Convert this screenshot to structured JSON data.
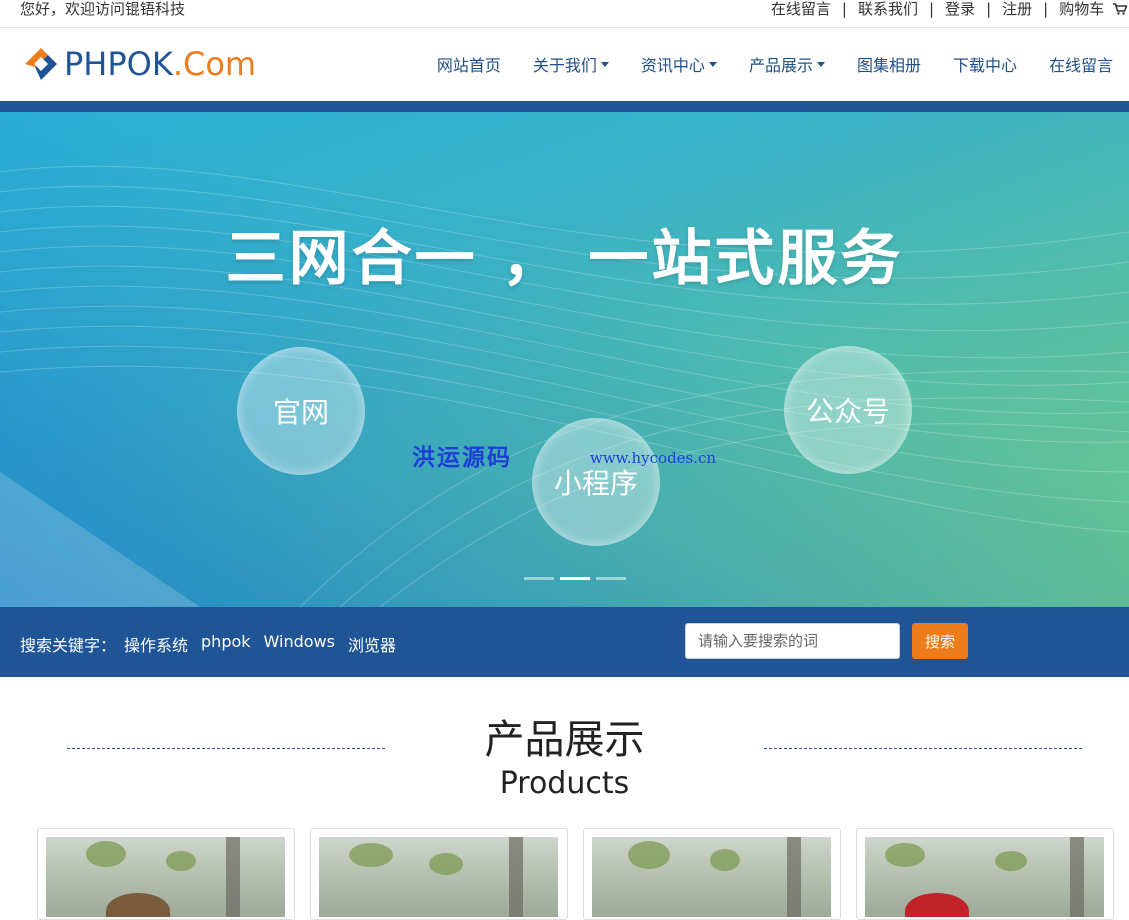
{
  "topbar": {
    "welcome": "您好，欢迎访问锟铻科技",
    "links": [
      "在线留言",
      "联系我们",
      "登录",
      "注册",
      "购物车"
    ],
    "separator": "|"
  },
  "logo": {
    "part1": "PHPOK",
    "part2": ".Com"
  },
  "nav": {
    "items": [
      {
        "label": "网站首页",
        "dropdown": false
      },
      {
        "label": "关于我们",
        "dropdown": true
      },
      {
        "label": "资讯中心",
        "dropdown": true
      },
      {
        "label": "产品展示",
        "dropdown": true
      },
      {
        "label": "图集相册",
        "dropdown": false
      },
      {
        "label": "下载中心",
        "dropdown": false
      },
      {
        "label": "在线留言",
        "dropdown": false
      }
    ]
  },
  "banner": {
    "headline": "三网合一 ， 一站式服务",
    "bubbles": [
      "官网",
      "小程序",
      "公众号"
    ],
    "slides": 3,
    "active_slide": 2,
    "watermark_cn": "洪运源码",
    "watermark_en": "www.hycodes.cn"
  },
  "search": {
    "label": "搜索关键字：",
    "keywords": [
      "操作系统",
      "phpok",
      "Windows",
      "浏览器"
    ],
    "placeholder": "请输入要搜索的词",
    "button": "搜索"
  },
  "section": {
    "title": "产品展示",
    "subtitle": "Products"
  },
  "colors": {
    "brand_blue": "#1f5596",
    "accent_orange": "#ec7c1c"
  }
}
